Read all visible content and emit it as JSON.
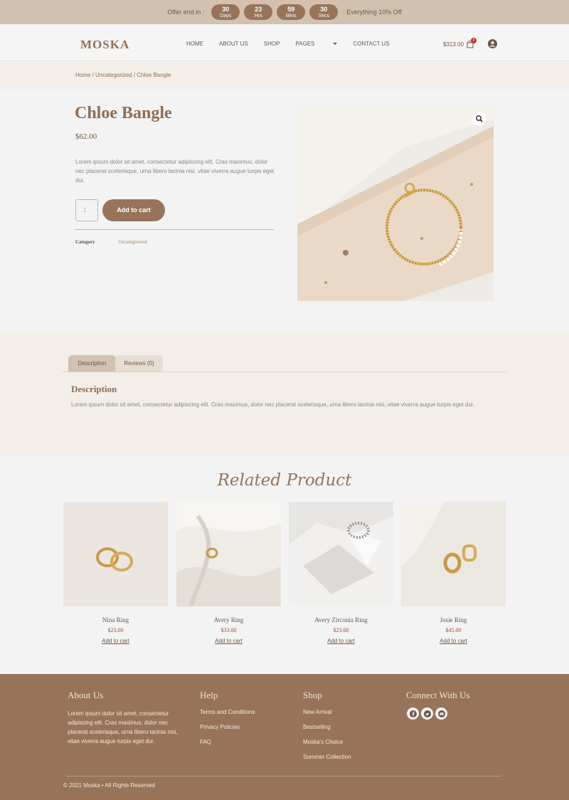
{
  "promo": {
    "label": "Offer end in :",
    "countdown": [
      {
        "value": "30",
        "unit": "Days"
      },
      {
        "value": "23",
        "unit": "Hrs"
      },
      {
        "value": "59",
        "unit": "Mins"
      },
      {
        "value": "30",
        "unit": "Secs"
      }
    ],
    "offer": "Everything 10% Off"
  },
  "header": {
    "logo": "MOSKA",
    "nav": [
      "HOME",
      "ABOUT US",
      "SHOP",
      "PAGES",
      "CONTACT US"
    ],
    "cart_total": "$313.00",
    "cart_count": "2"
  },
  "breadcrumb": "Home / Uncategorized / Chloe Bangle",
  "product": {
    "title": "Chloe Bangle",
    "price": "$62.00",
    "description": "Lorem ipsum dolor sit amet, consectetur adipiscing elit. Cras maximus, dolor nec placerat scelerisque, urna libero lacinia nisi, vitae viverra augue turpis eget dui.",
    "quantity": "1",
    "add_to_cart": "Add to cart",
    "category_label": "Category",
    "category_value": "Uncategorized"
  },
  "tabs": {
    "items": [
      "Description",
      "Reviews (0)"
    ],
    "heading": "Description",
    "body": "Lorem ipsum dolor sit amet, consectetur adipiscing elit. Cras maximus, dolor nec placerat scelerisque, urna libero lacinia nisi, vitae viverra augue turpis eget dui."
  },
  "related": {
    "title": "Related Product",
    "products": [
      {
        "name": "Nina Ring",
        "price": "$23.00",
        "cta": "Add to cart"
      },
      {
        "name": "Avery Ring",
        "price": "$33.00",
        "cta": "Add to cart"
      },
      {
        "name": "Avery Zirconia Ring",
        "price": "$23.00",
        "cta": "Add to cart"
      },
      {
        "name": "Josie Ring",
        "price": "$45.00",
        "cta": "Add to cart"
      }
    ]
  },
  "footer": {
    "about_title": "About Us",
    "about_text": "Lorem ipsum dolor sit amet, consectetur adipiscing elit. Cras maximus, dolor nec placerat scelerisque, urna libero lacinia nisi, vitae viverra augue turpis eget dui.",
    "help_title": "Help",
    "help_links": [
      "Terms and Conditions",
      "Privacy Policies",
      "FAQ"
    ],
    "shop_title": "Shop",
    "shop_links": [
      "New Arrival",
      "Bestselling",
      "Moska's Choice",
      "Summer Collection"
    ],
    "connect_title": "Connect With Us",
    "social_icons": [
      "facebook-icon",
      "twitter-icon",
      "youtube-icon"
    ],
    "copyright": "© 2021 Moska • All Rights Reserved"
  },
  "colors": {
    "accent": "#977459",
    "promo_bg": "#d2c1ae",
    "price_red": "#a3462f"
  }
}
